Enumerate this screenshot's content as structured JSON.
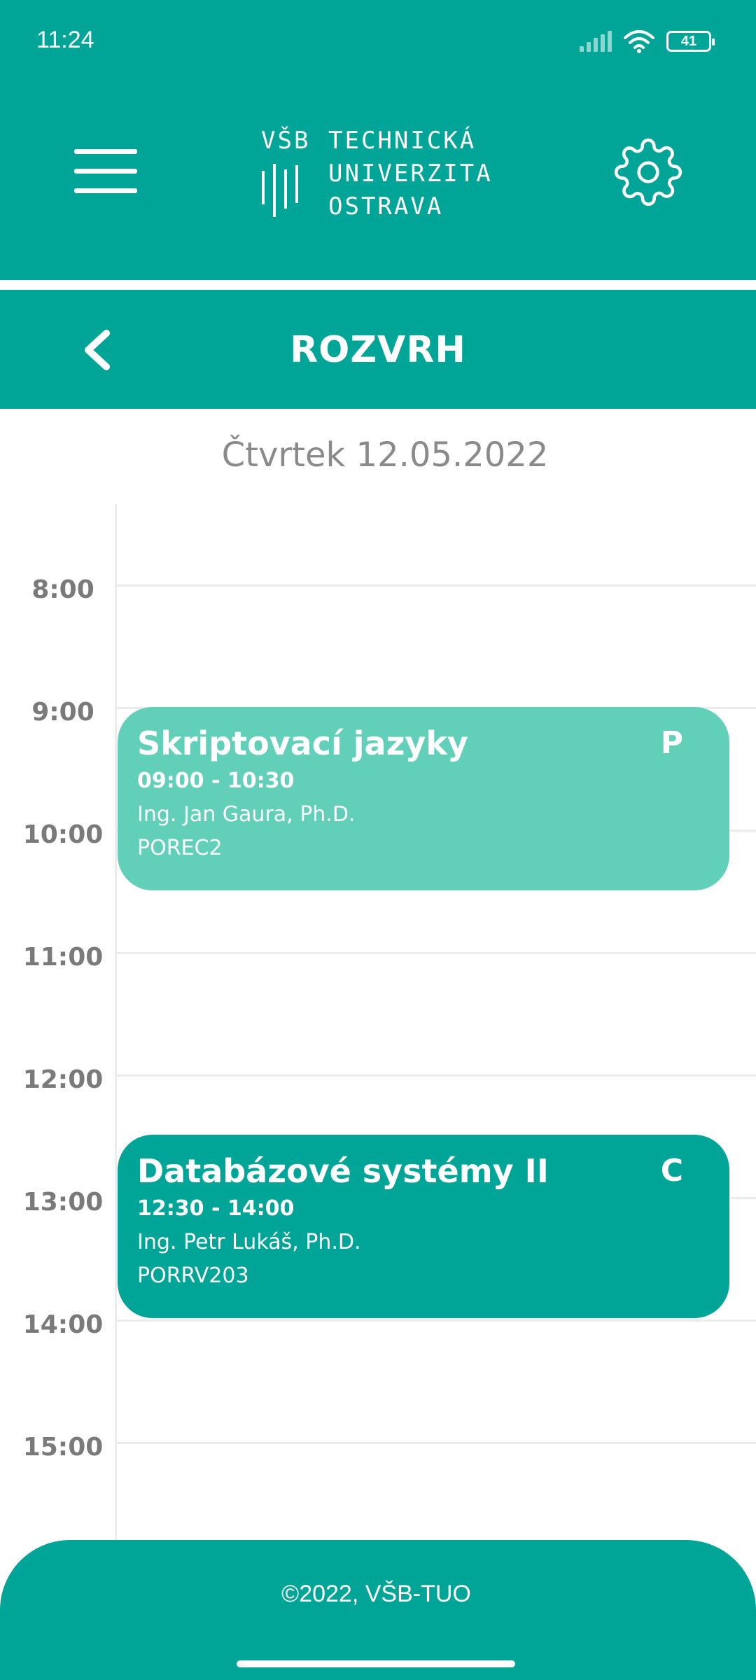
{
  "status_bar": {
    "time": "11:24",
    "battery": "41"
  },
  "header": {
    "logo": {
      "line1_prefix": "VŠB",
      "line1": "TECHNICKÁ",
      "line2": "UNIVERZITA",
      "line3": "OSTRAVA"
    }
  },
  "page": {
    "title": "ROZVRH",
    "date": "Čtvrtek 12.05.2022"
  },
  "timeline": {
    "hours": [
      "8:00",
      "9:00",
      "10:00",
      "11:00",
      "12:00",
      "13:00",
      "14:00",
      "15:00"
    ]
  },
  "events": [
    {
      "title": "Skriptovací jazyky",
      "type": "P",
      "time": "09:00 - 10:30",
      "teacher": "Ing. Jan Gaura, Ph.D.",
      "room": "POREC2",
      "color": "#62CFB9"
    },
    {
      "title": "Databázové systémy II",
      "type": "C",
      "time": "12:30 - 14:00",
      "teacher": "Ing. Petr Lukáš, Ph.D.",
      "room": "PORRV203",
      "color": "#00A597"
    }
  ],
  "footer": {
    "copyright": "©2022, VŠB-TUO"
  },
  "colors": {
    "primary": "#00A597",
    "lecture": "#62CFB9",
    "text_muted": "#8a8a8a"
  }
}
